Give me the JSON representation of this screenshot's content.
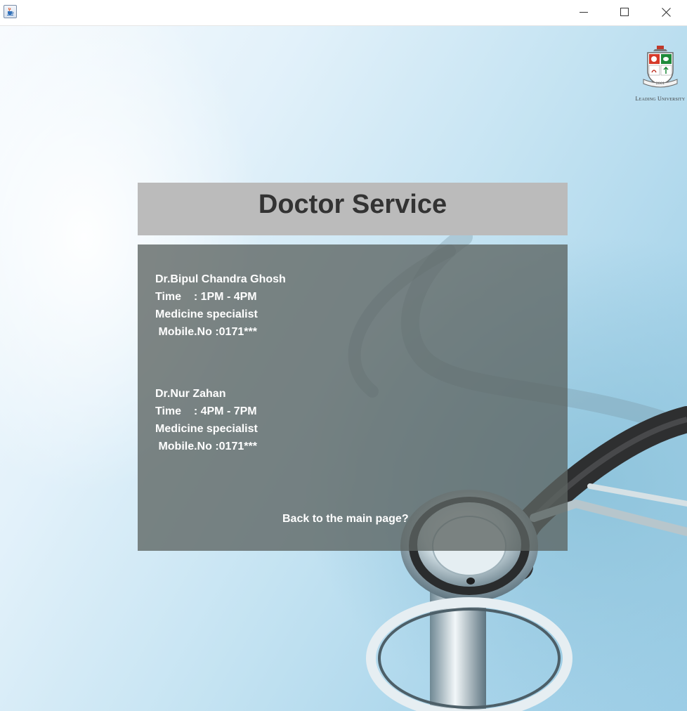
{
  "window": {
    "app_icon": "java-cup-icon",
    "controls": [
      "minimize-icon",
      "maximize-icon",
      "close-icon"
    ]
  },
  "logo": {
    "icon": "university-crest-icon",
    "text": "Leading University"
  },
  "header": {
    "title": "Doctor Service"
  },
  "doctors": [
    {
      "name": "Dr.Bipul Chandra Ghosh",
      "time": "Time    : 1PM - 4PM",
      "specialty": "Medicine specialist",
      "mobile": " Mobile.No :0171***"
    },
    {
      "name": "Dr.Nur Zahan",
      "time": "Time    : 4PM - 7PM",
      "specialty": "Medicine specialist",
      "mobile": " Mobile.No :0171***"
    }
  ],
  "back_link": "Back to the main page?",
  "colors": {
    "header_bg": "#bbbbbb",
    "title_text": "#333333",
    "panel_bg": "#5c6462",
    "panel_text": "#ffffff"
  }
}
